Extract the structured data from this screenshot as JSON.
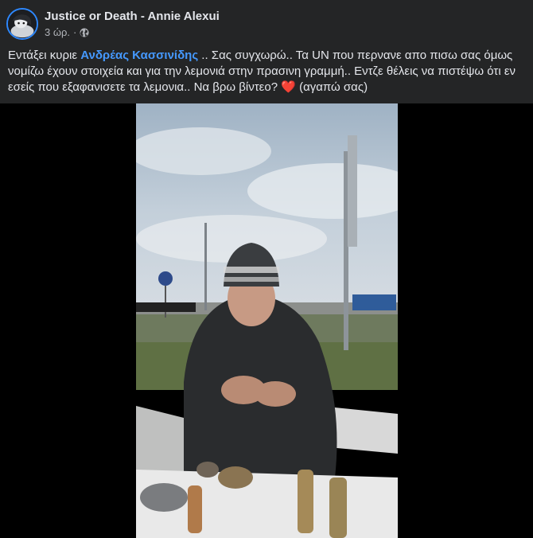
{
  "post": {
    "author": "Justice or Death - Annie Alexui",
    "time": "3 ώρ.",
    "separator": "·",
    "privacy_icon": "globe-icon",
    "text_before": "Εντάξει κυριε ",
    "mention": "Ανδρέας Κασσινίδης",
    "text_after": " .. Σας συγχωρώ.. Τα UN που περνανε απο πισω σας όμως νομίζω έχουν στοιχεία και για την λεμονιά στην πρασινη γραμμή.. Εντζε θέλεις να πιστέψω ότι εν εσείς που εξαφανισετε τα λεμονια.. Να βρω βίντεο? ",
    "heart": "❤️",
    "text_end": " (αγαπώ σας)"
  },
  "colors": {
    "background": "#242526",
    "text": "#e4e6eb",
    "secondary_text": "#b0b3b8",
    "mention": "#4599ff",
    "avatar_ring": "#2d88ff"
  }
}
